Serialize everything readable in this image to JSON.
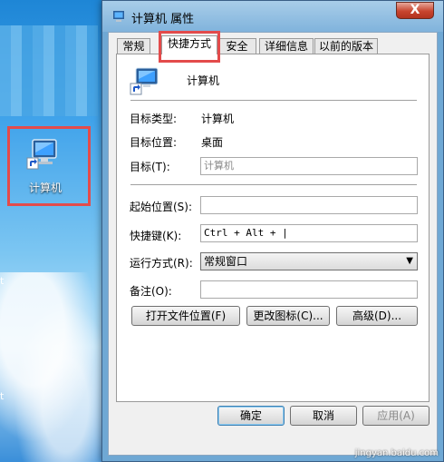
{
  "desktop": {
    "icon_label": "计算机",
    "edge_chars": [
      "t",
      "t"
    ]
  },
  "window": {
    "title": "计算机 属性",
    "close_glyph": "X",
    "tabs": [
      {
        "label": "常规"
      },
      {
        "label": "快捷方式"
      },
      {
        "label": "安全"
      },
      {
        "label": "详细信息"
      },
      {
        "label": "以前的版本"
      }
    ],
    "active_tab": "快捷方式",
    "shortcut_name": "计算机",
    "fields": {
      "target_type_label": "目标类型:",
      "target_type_value": "计算机",
      "target_location_label": "目标位置:",
      "target_location_value": "桌面",
      "target_label": "目标(T):",
      "target_value": "计算机",
      "start_in_label": "起始位置(S):",
      "start_in_value": "",
      "hotkey_label": "快捷键(K):",
      "hotkey_value": "Ctrl + Alt + |",
      "run_label": "运行方式(R):",
      "run_value": "常规窗口",
      "comment_label": "备注(O):",
      "comment_value": ""
    },
    "buttons": {
      "open_location": "打开文件位置(F)",
      "change_icon": "更改图标(C)...",
      "advanced": "高级(D)...",
      "ok": "确定",
      "cancel": "取消",
      "apply": "应用(A)"
    }
  },
  "watermark": "jingyan.baidu.com",
  "colors": {
    "highlight_box": "#e34b4b",
    "titlebar": "#80b3dc",
    "close_button": "#c8452f"
  },
  "icons": [
    "computer-icon",
    "shortcut-arrow-icon",
    "close-icon",
    "dropdown-arrow-icon"
  ]
}
